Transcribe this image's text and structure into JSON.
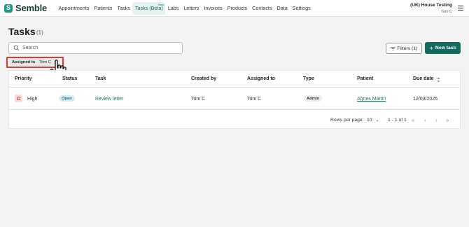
{
  "app": {
    "brand": "Semble",
    "brand_mark": "S"
  },
  "nav": {
    "items": [
      {
        "label": "Appointments"
      },
      {
        "label": "Patients"
      },
      {
        "label": "Tasks"
      },
      {
        "label": "Tasks (Beta)",
        "badge": "New"
      },
      {
        "label": "Labs"
      },
      {
        "label": "Letters"
      },
      {
        "label": "Invoices"
      },
      {
        "label": "Products"
      },
      {
        "label": "Contacts"
      },
      {
        "label": "Data"
      },
      {
        "label": "Settings"
      }
    ],
    "active_label": "Tasks (Beta)"
  },
  "user": {
    "org": "(UK) House Testing",
    "name": "Tom C"
  },
  "page": {
    "title": "Tasks",
    "count": "(1)"
  },
  "search": {
    "placeholder": "Search",
    "value": ""
  },
  "toolbar": {
    "filters_label": "Filters (1)",
    "new_task_label": "New task"
  },
  "active_filter": {
    "label": "Assigned to",
    "value": "Tom C"
  },
  "table": {
    "columns": [
      "Priority",
      "Status",
      "Task",
      "Created by",
      "Assigned to",
      "Type",
      "Patient",
      "Due date"
    ],
    "rows": [
      {
        "priority": "High",
        "status": "Open",
        "task": "Review letter",
        "created_by": "Tom C",
        "assigned_to": "Tom C",
        "type": "Admin",
        "patient": "Agnes Martin",
        "due_date": "12/03/2026"
      }
    ]
  },
  "pagination": {
    "rows_per_page_label": "Rows per page:",
    "rows_per_page": "10",
    "range": "1 - 1 of 1"
  },
  "colors": {
    "brand": "#1e9b86",
    "primary_button": "#136b5e",
    "highlight": "#e53935",
    "link": "#1b7a66",
    "status_open_bg": "#d5ecf2"
  },
  "icons": [
    "brand-logo-icon",
    "hamburger-menu-icon",
    "search-icon",
    "filter-icon",
    "plus-icon",
    "close-icon",
    "pointer-hand-cursor-icon",
    "priority-flag-icon",
    "sort-icon",
    "chevron-down-icon",
    "first-page-icon",
    "prev-page-icon",
    "next-page-icon",
    "last-page-icon"
  ]
}
